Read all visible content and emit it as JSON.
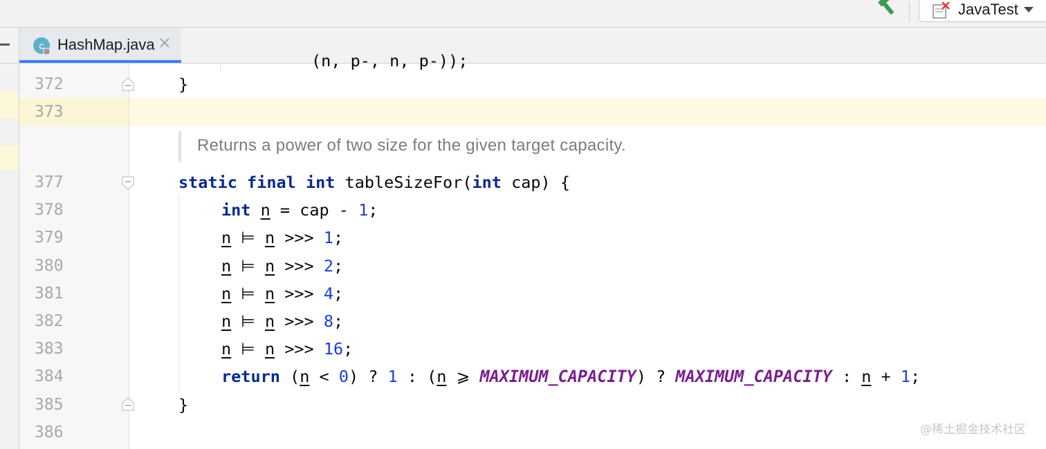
{
  "toolbar": {
    "build_icon": "hammer-icon",
    "run_config": {
      "label": "JavaTest",
      "icon": "java-file-icon",
      "dropdown_icon": "chevron-down-icon"
    }
  },
  "tabs": [
    {
      "label": "HashMap.java",
      "icon": "class-c-icon",
      "close_icon": "close-icon",
      "active": true
    }
  ],
  "editor": {
    "highlight_color": "#fdf9e3",
    "partial_top_line": "(n, p-, n, p-));",
    "doc_comment": "Returns a power of two size for the given target capacity.",
    "lines": [
      {
        "num": "372"
      },
      {
        "num": "373"
      },
      {
        "num": "377"
      },
      {
        "num": "378"
      },
      {
        "num": "379"
      },
      {
        "num": "380"
      },
      {
        "num": "381"
      },
      {
        "num": "382"
      },
      {
        "num": "383"
      },
      {
        "num": "384"
      },
      {
        "num": "385"
      },
      {
        "num": "386"
      }
    ],
    "tokens": {
      "brace_close": "}",
      "l377": {
        "kw1": "static",
        "kw2": "final",
        "kw3": "int",
        "name": "tableSizeFor(",
        "kw4": "int",
        "rest": "cap) {"
      },
      "l378": {
        "kw": "int",
        "var": "n",
        "rest": " = cap - ",
        "num": "1",
        "semi": ";"
      },
      "l379": {
        "a": "n",
        "op": " ⊨ ",
        "b": "n",
        "shift": " >>> ",
        "num": "1",
        "semi": ";"
      },
      "l380": {
        "a": "n",
        "op": " ⊨ ",
        "b": "n",
        "shift": " >>> ",
        "num": "2",
        "semi": ";"
      },
      "l381": {
        "a": "n",
        "op": " ⊨ ",
        "b": "n",
        "shift": " >>> ",
        "num": "4",
        "semi": ";"
      },
      "l382": {
        "a": "n",
        "op": " ⊨ ",
        "b": "n",
        "shift": " >>> ",
        "num": "8",
        "semi": ";"
      },
      "l383": {
        "a": "n",
        "op": " ⊨ ",
        "b": "n",
        "shift": " >>> ",
        "num": "16",
        "semi": ";"
      },
      "l384": {
        "kw": "return",
        "p1": " (",
        "n1": "n",
        "lt": " < ",
        "zero": "0",
        "p2": ") ? ",
        "one1": "1",
        "colon1": " : (",
        "n2": "n",
        "ge": " ⩾ ",
        "c1": "MAXIMUM_CAPACITY",
        "p3": ") ? ",
        "c2": "MAXIMUM_CAPACITY",
        "colon2": " : ",
        "n3": "n",
        "plus": " + ",
        "one2": "1",
        "semi": ";"
      }
    }
  },
  "watermark": "@稀土掘金技术社区"
}
